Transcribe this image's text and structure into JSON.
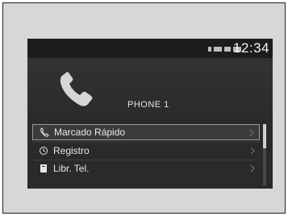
{
  "status": {
    "time": "12:34"
  },
  "phone": {
    "device_name": "PHONE 1"
  },
  "menu": {
    "items": [
      {
        "label": "Marcado Rápido",
        "icon": "speed-dial-icon",
        "selected": true
      },
      {
        "label": "Registro",
        "icon": "history-icon",
        "selected": false
      },
      {
        "label": "Libr. Tel.",
        "icon": "phonebook-icon",
        "selected": false
      }
    ]
  },
  "colors": {
    "screen": "#2a2a2a",
    "text": "#e8e8e8",
    "frame": "#d7d7d7"
  }
}
